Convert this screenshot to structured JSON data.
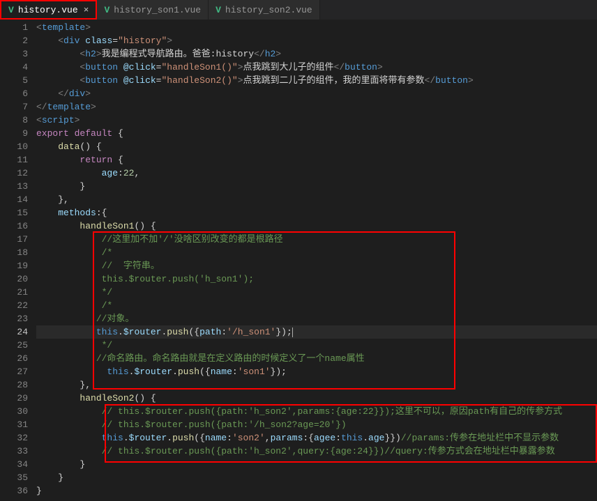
{
  "tabs": [
    {
      "name": "history.vue",
      "active": true
    },
    {
      "name": "history_son1.vue",
      "active": false
    },
    {
      "name": "history_son2.vue",
      "active": false
    }
  ],
  "lines": {
    "l1": {
      "lt": "<",
      "template": "template",
      "gt": ">"
    },
    "l2": {
      "lt": "<",
      "div": "div",
      "class": "class",
      "eq": "=",
      "val": "\"history\"",
      "gt": ">"
    },
    "l3": {
      "o": "<",
      "h2": "h2",
      "og": ">",
      "text": "我是编程式导航路由。爸爸:history",
      "c": "</",
      "cg": ">"
    },
    "l4": {
      "o": "<",
      "button": "button",
      "at": "@click",
      "eq": "=",
      "val": "\"handleSon1()\"",
      "og": ">",
      "text": "点我跳到大儿子的组件",
      "c": "</",
      "cg": ">"
    },
    "l5": {
      "o": "<",
      "button": "button",
      "at": "@click",
      "eq": "=",
      "val": "\"handleSon2()\"",
      "og": ">",
      "text": "点我跳到二儿子的组件，我的里面将带有参数",
      "c": "</",
      "cg": ">"
    },
    "l6": {
      "c": "</",
      "div": "div",
      "gt": ">"
    },
    "l7": {
      "c": "</",
      "template": "template",
      "gt": ">"
    },
    "l8": {
      "o": "<",
      "script": "script",
      "gt": ">"
    },
    "l9": {
      "export": "export",
      "default": "default",
      "brace": " {"
    },
    "l10": {
      "data": "data",
      "rest": "() {"
    },
    "l11": {
      "return": "return",
      "brace": " {"
    },
    "l12": {
      "age": "age",
      "colon": ":",
      "num": "22",
      "comma": ","
    },
    "l13": {
      "brace": "}"
    },
    "l14": {
      "brace": "},"
    },
    "l15": {
      "methods": "methods",
      "rest": ":{"
    },
    "l16": {
      "fn": "handleSon1",
      "rest": "() {"
    },
    "l17": {
      "comment": "//这里加不加'/'没啥区别改变的都是根路径"
    },
    "l18": {
      "comment": "/*"
    },
    "l19": {
      "comment": "//  字符串。"
    },
    "l20": {
      "comment": "this.$router.push('h_son1');"
    },
    "l21": {
      "comment": "*/"
    },
    "l22": {
      "comment": "/*"
    },
    "l23": {
      "comment": "//对象。"
    },
    "l24": {
      "this": "this",
      "dot": ".",
      "router": "$router",
      "push": "push",
      "o": "({",
      "path": "path",
      "c": ":",
      "val": "'/h_son1'",
      "end": "});"
    },
    "l25": {
      "comment": "*/"
    },
    "l26": {
      "comment": "//命名路由。命名路由就是在定义路由的时候定义了一个name属性"
    },
    "l27": {
      "this": "this",
      "dot": ".",
      "router": "$router",
      "push": "push",
      "o": "({",
      "name": "name",
      "c": ":",
      "val": "'son1'",
      "end": "});"
    },
    "l28": {
      "brace": "},"
    },
    "l29": {
      "fn": "handleSon2",
      "rest": "() {"
    },
    "l30": {
      "comment": "// this.$router.push({path:'h_son2',params:{age:22}});这里不可以，原因path有自己的传参方式"
    },
    "l31": {
      "comment": "// this.$router.push({path:'/h_son2?age=20'})"
    },
    "l32": {
      "this": "this",
      "dot": ".",
      "router": "$router",
      "push": "push",
      "o": "({",
      "name": "name",
      "c1": ":",
      "v1": "'son2'",
      "cm": ",",
      "params": "params",
      "c2": ":{",
      "agee": "agee",
      "c3": ":",
      "this2": "this",
      "d2": ".",
      "age": "age",
      "end": "}})",
      "comment": "//params:传参在地址栏中不显示参数"
    },
    "l33": {
      "comment": "// this.$router.push({path:'h_son2',query:{age:24}})//query:传参方式会在地址栏中暴露参数"
    },
    "l34": {
      "brace": "}"
    },
    "l35": {
      "brace": "}"
    },
    "l36": {
      "brace": "}"
    }
  },
  "activeLineNum": 24
}
